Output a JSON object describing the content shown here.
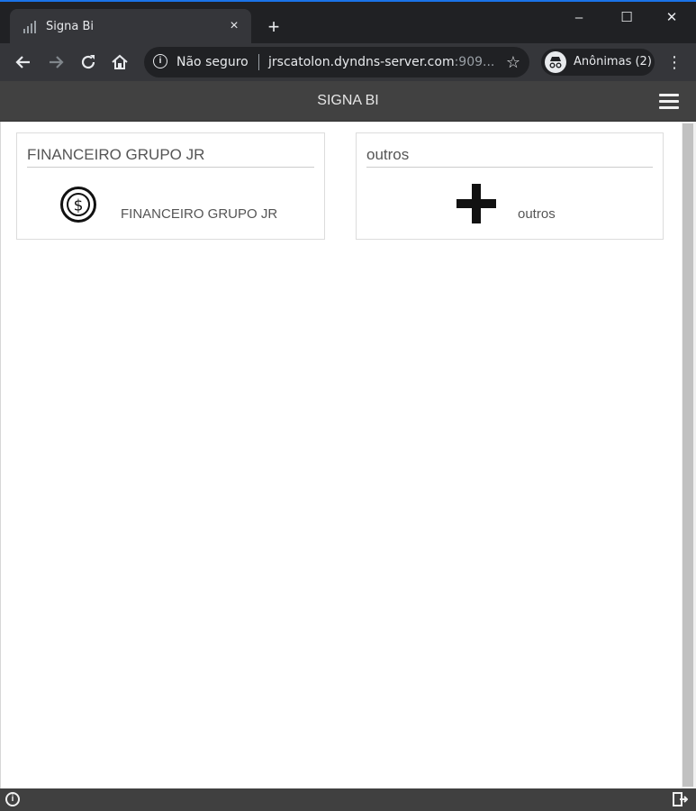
{
  "browser": {
    "tab_title": "Signa Bi",
    "tab_close_label": "×",
    "new_tab_label": "+",
    "security_label": "Não seguro",
    "url_host": "jrscatolon.dyndns-server.com",
    "url_rest": ":909...",
    "profile_label": "Anônimas (2)",
    "window_controls": {
      "minimize": "–",
      "maximize": "☐",
      "close": "✕"
    }
  },
  "app": {
    "title": "SIGNA BI",
    "cards": [
      {
        "title": "FINANCEIRO GRUPO JR",
        "icon": "dollar-circle-icon",
        "label": "FINANCEIRO GRUPO JR"
      },
      {
        "title": "outros",
        "icon": "plus-icon",
        "label": "outros"
      }
    ]
  },
  "colors": {
    "chrome_dark": "#202124",
    "chrome_toolbar": "#35363a",
    "app_header": "#414141",
    "footer": "#404040"
  }
}
